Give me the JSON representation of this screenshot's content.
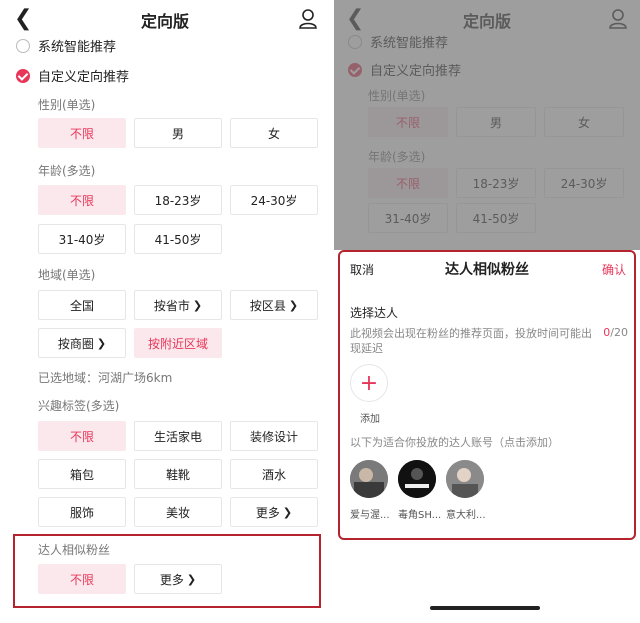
{
  "header": {
    "title": "定向版"
  },
  "targeting": {
    "system_option": "系统智能推荐",
    "custom_option": "自定义定向推荐",
    "gender": {
      "label": "性别(单选)",
      "options": [
        "不限",
        "男",
        "女"
      ]
    },
    "age": {
      "label": "年龄(多选)",
      "options": [
        "不限",
        "18-23岁",
        "24-30岁",
        "31-40岁",
        "41-50岁"
      ]
    },
    "region": {
      "label": "地域(单选)",
      "options": [
        "全国",
        "按省市",
        "按区县",
        "按商圈",
        "按附近区域"
      ],
      "selected_note": "已选地域：河湖广场6km"
    },
    "interest": {
      "label": "兴趣标签(多选)",
      "options": [
        "不限",
        "生活家电",
        "装修设计",
        "箱包",
        "鞋靴",
        "酒水",
        "服饰",
        "美妆",
        "更多"
      ]
    },
    "similar_fans": {
      "label": "达人相似粉丝",
      "options": [
        "不限",
        "更多"
      ]
    }
  },
  "sheet": {
    "cancel": "取消",
    "title": "达人相似粉丝",
    "confirm": "确认",
    "heading": "选择达人",
    "description": "此视频会出现在粉丝的推荐页面，投放时间可能出现延迟",
    "count_current": "0",
    "count_max": "/20",
    "add_label": "添加",
    "subheading": "以下为适合你投放的达人账号（点击添加）",
    "creators": [
      "爱与渥...",
      "毒角SH...",
      "意大利..."
    ]
  },
  "colors": {
    "accent": "#e8365a",
    "highlight_box": "#b5232e",
    "selected_bg": "#fbe8ec"
  }
}
